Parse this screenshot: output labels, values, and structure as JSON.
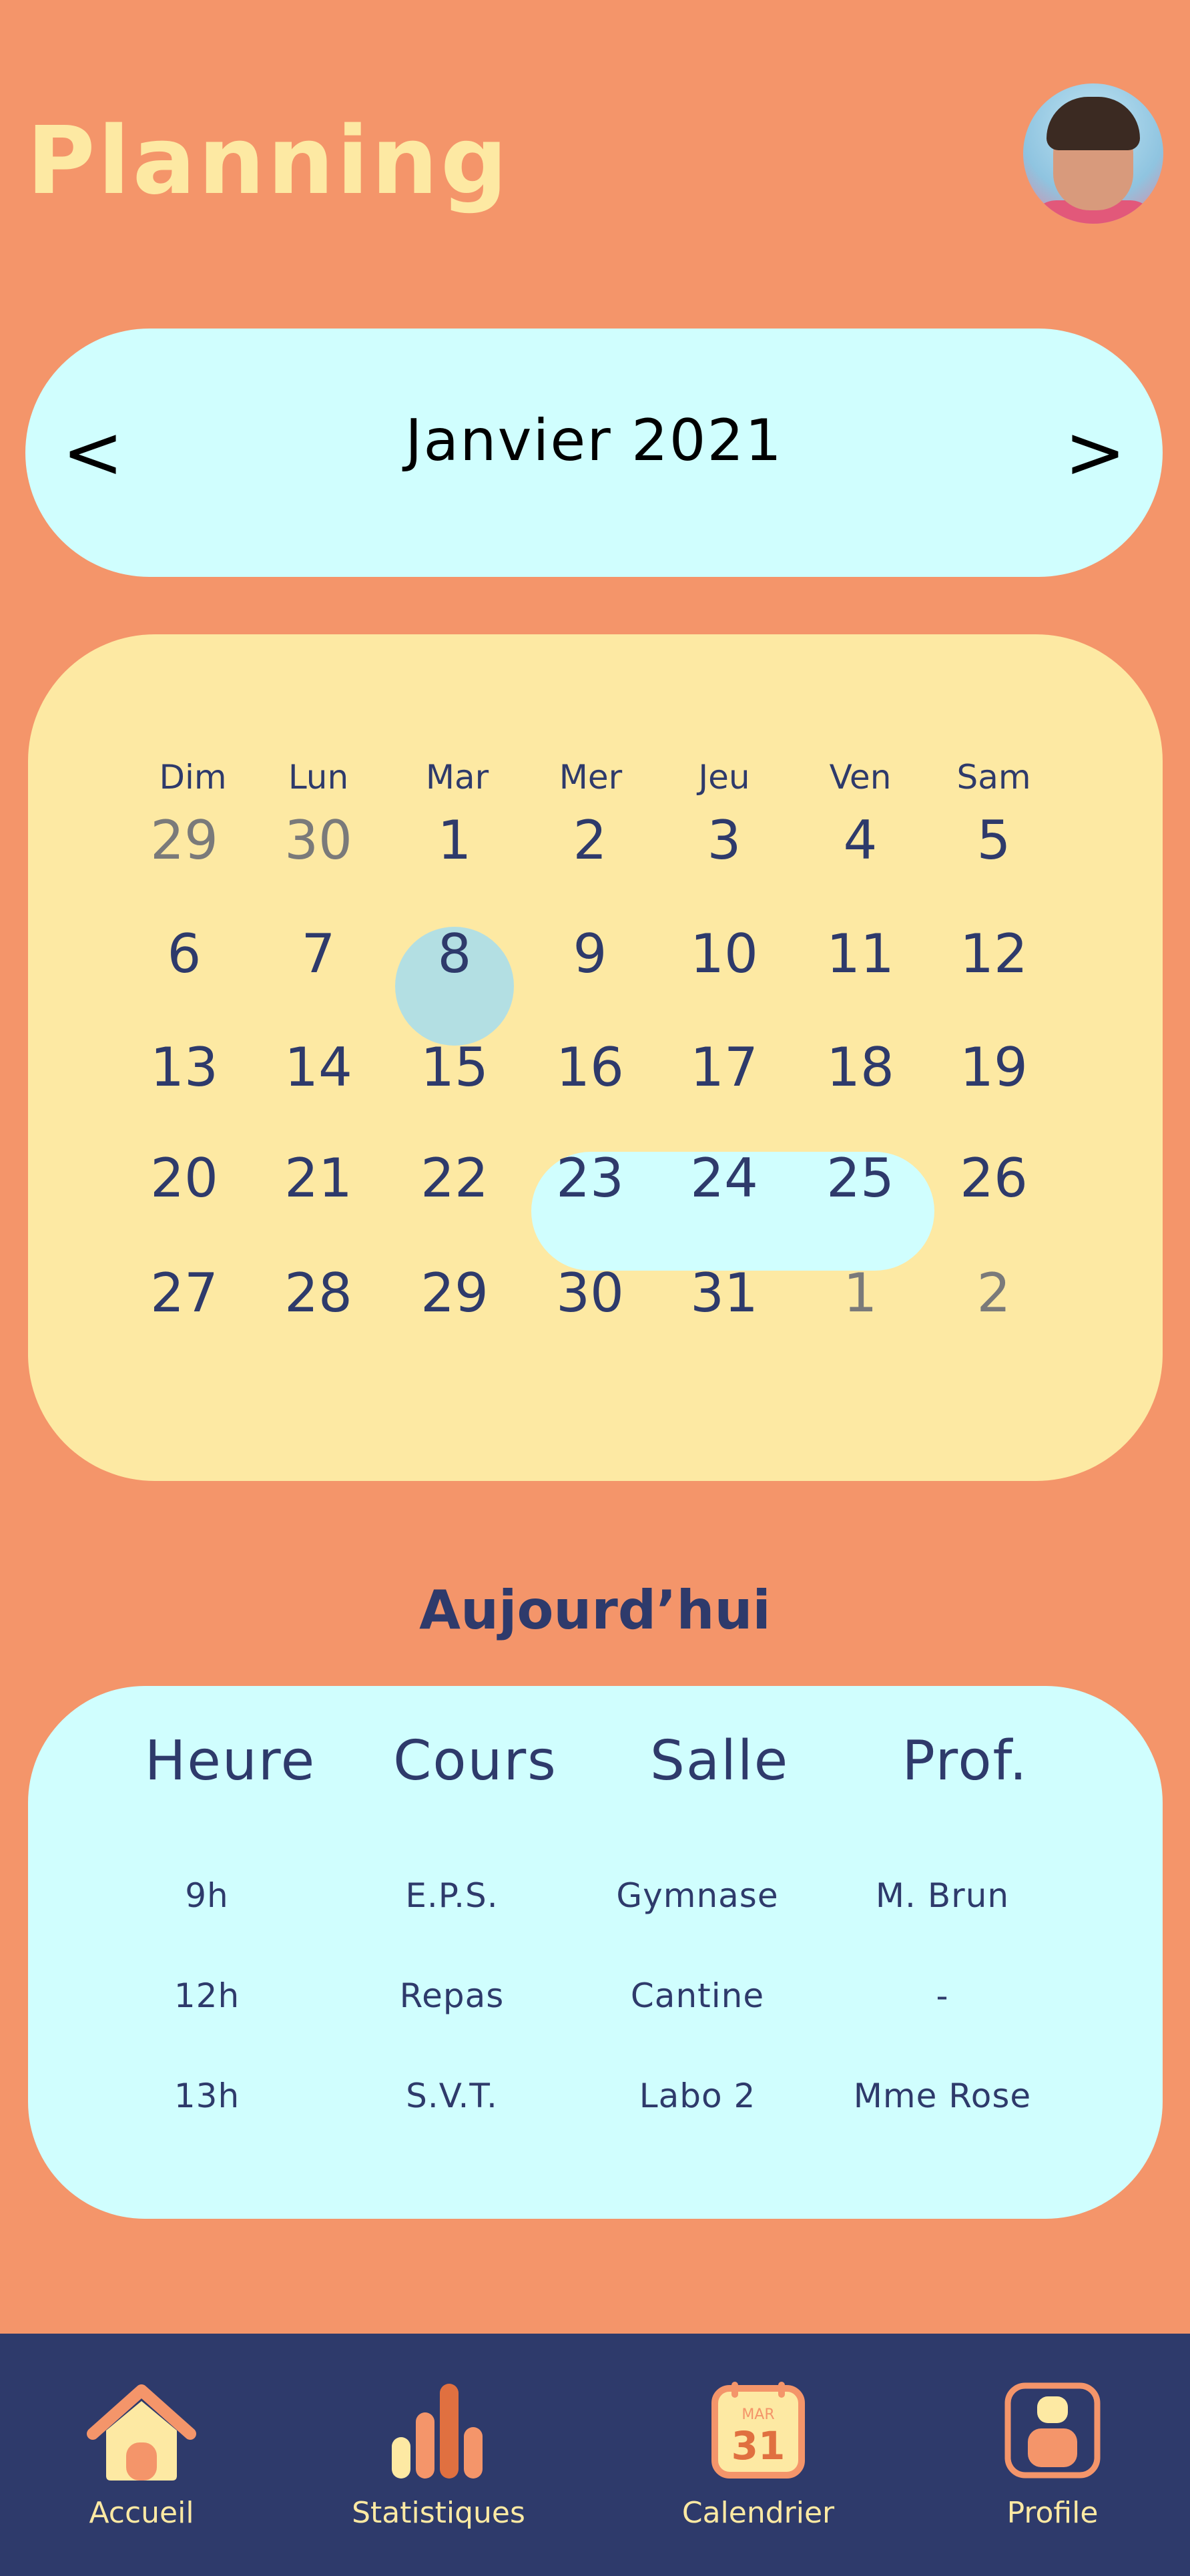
{
  "header": {
    "title": "Planning"
  },
  "month_nav": {
    "prev": "<",
    "label": "Janvier 2021",
    "next": ">"
  },
  "calendar": {
    "weekdays": [
      "Dim",
      "Lun",
      "Mar",
      "Mer",
      "Jeu",
      "Ven",
      "Sam"
    ],
    "weeks": [
      [
        "29",
        "30",
        "1",
        "2",
        "3",
        "4",
        "5"
      ],
      [
        "6",
        "7",
        "8",
        "9",
        "10",
        "11",
        "12"
      ],
      [
        "13",
        "14",
        "15",
        "16",
        "17",
        "18",
        "19"
      ],
      [
        "20",
        "21",
        "22",
        "23",
        "24",
        "25",
        "26"
      ],
      [
        "27",
        "28",
        "29",
        "30",
        "31",
        "1",
        "2"
      ]
    ],
    "selected_day": "8",
    "highlighted_range": [
      "23",
      "24",
      "25"
    ]
  },
  "today": {
    "title": "Aujourd’hui",
    "headers": [
      "Heure",
      "Cours",
      "Salle",
      "Prof."
    ],
    "rows": [
      [
        "9h",
        "E.P.S.",
        "Gymnase",
        "M. Brun"
      ],
      [
        "12h",
        "Repas",
        "Cantine",
        "-"
      ],
      [
        "13h",
        "S.V.T.",
        "Labo 2",
        "Mme Rose"
      ]
    ]
  },
  "navbar": {
    "accueil": "Accueil",
    "statistiques": "Statistiques",
    "calendrier": "Calendrier",
    "calendar_icon_month": "MAR",
    "calendar_icon_day": "31",
    "profile": "Profile"
  },
  "colors": {
    "background": "#F4956A",
    "title": "#FDE9A3",
    "panel_cyan": "#D0FEFE",
    "panel_yellow": "#FDE9A3",
    "text_dark": "#2E3A6B",
    "selected_circle": "#B3DFE3",
    "navbar": "#2E3A6B"
  }
}
